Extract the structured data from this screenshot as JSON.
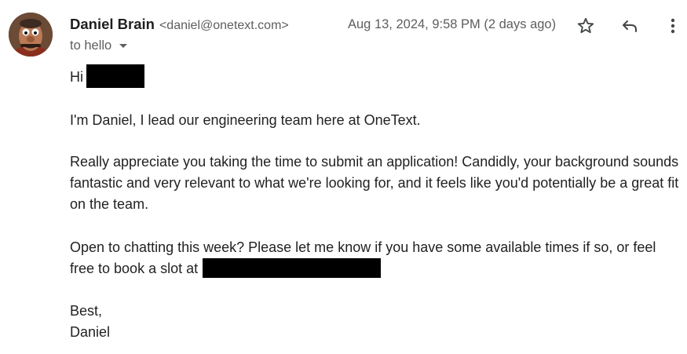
{
  "header": {
    "sender_name": "Daniel Brain",
    "sender_email": "<daniel@onetext.com>",
    "date": "Aug 13, 2024, 9:58 PM (2 days ago)",
    "recipient": "to hello"
  },
  "icons": {
    "star": "star-icon",
    "reply": "reply-icon",
    "more": "more-vert-icon",
    "recipient_details": "caret-down-icon"
  },
  "body": {
    "greeting": "Hi",
    "para1": "I'm Daniel, I lead our engineering team here at OneText.",
    "para2_line1": "Really appreciate you taking the time to submit an application! Candidly, your background sounds",
    "para2_line2": "fantastic and very relevant to what we're looking for, and it feels like you'd potentially be a great fit",
    "para2_line3": "on the team.",
    "para3_line1": "Open to chatting this week? Please let me know if you have some available times if so, or feel",
    "para3_line2": "free to book a slot at",
    "signoff": "Best,",
    "signature": "Daniel"
  },
  "colors": {
    "text": "#222222",
    "muted": "#5e5e5e",
    "redaction": "#000000"
  }
}
